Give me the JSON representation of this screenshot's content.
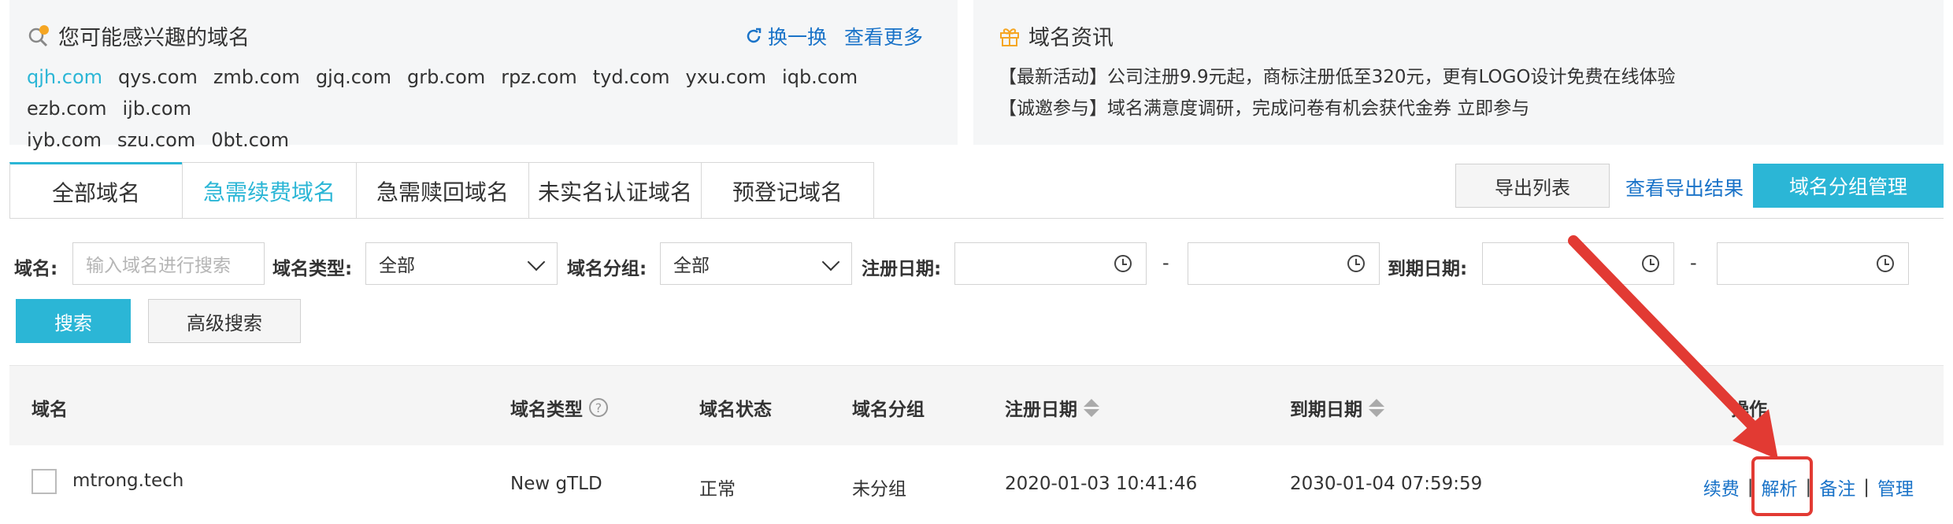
{
  "suggest": {
    "title": "您可能感兴趣的域名",
    "refresh_label": "换一换",
    "more_label": "查看更多",
    "domains": [
      "qjh.com",
      "qys.com",
      "zmb.com",
      "gjq.com",
      "grb.com",
      "rpz.com",
      "tyd.com",
      "yxu.com",
      "iqb.com",
      "ezb.com",
      "ijb.com",
      "iyb.com",
      "szu.com",
      "0bt.com"
    ]
  },
  "news": {
    "title": "域名资讯",
    "items": [
      "【最新活动】公司注册9.9元起，商标注册低至320元，更有LOGO设计免费在线体验",
      "【诚邀参与】域名满意度调研，完成问卷有机会获代金券 立即参与"
    ]
  },
  "tabs": [
    "全部域名",
    "急需续费域名",
    "急需赎回域名",
    "未实名认证域名",
    "预登记域名"
  ],
  "toolbar": {
    "export_label": "导出列表",
    "view_export_label": "查看导出结果",
    "group_manage_label": "域名分组管理"
  },
  "filters": {
    "domain_label": "域名:",
    "domain_placeholder": "输入域名进行搜索",
    "type_label": "域名类型:",
    "type_value": "全部",
    "group_label": "域名分组:",
    "group_value": "全部",
    "reg_date_label": "注册日期:",
    "exp_date_label": "到期日期:",
    "dash": "-",
    "search_label": "搜索",
    "advanced_label": "高级搜索"
  },
  "table": {
    "headers": {
      "domain": "域名",
      "type": "域名类型",
      "status": "域名状态",
      "group": "域名分组",
      "reg_date": "注册日期",
      "exp_date": "到期日期",
      "actions": "操作"
    },
    "row": {
      "domain": "mtrong.tech",
      "type": "New gTLD",
      "status": "正常",
      "group": "未分组",
      "reg_date": "2020-01-03 10:41:46",
      "exp_date": "2030-01-04 07:59:59",
      "ops": [
        "续费",
        "解析",
        "备注",
        "管理"
      ]
    }
  },
  "colors": {
    "accent": "#2bb6d6",
    "link": "#1a73c8",
    "annotation": "#e23a33"
  }
}
